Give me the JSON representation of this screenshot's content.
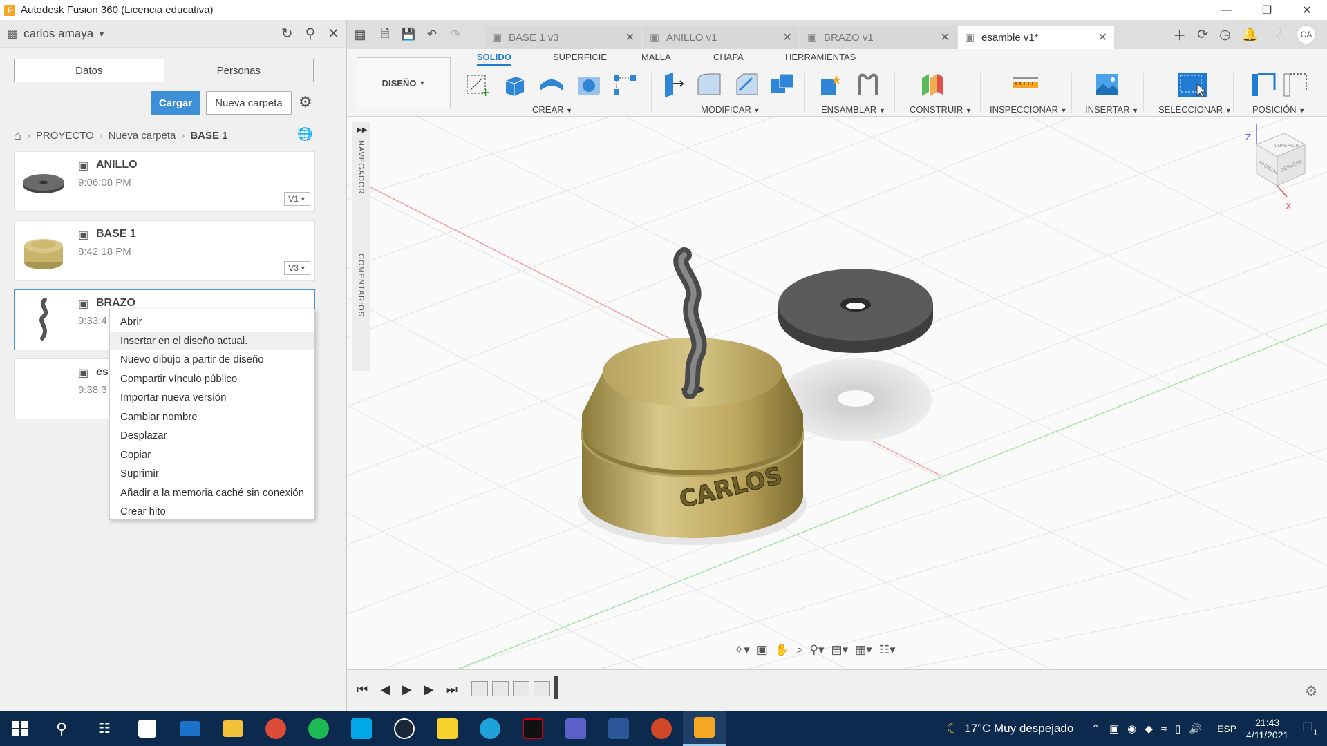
{
  "window": {
    "title": "Autodesk Fusion 360 (Licencia educativa)",
    "app_icon": "F"
  },
  "left_panel": {
    "user": "carlos amaya",
    "tabs": [
      "Datos",
      "Personas"
    ],
    "upload_label": "Cargar",
    "new_folder_label": "Nueva carpeta",
    "breadcrumb": [
      "PROYECTO",
      "Nueva carpeta",
      "BASE 1"
    ],
    "files": [
      {
        "name": "ANILLO",
        "time": "9:06:08 PM",
        "version": "V1"
      },
      {
        "name": "BASE 1",
        "time": "8:42:18 PM",
        "version": "V3"
      },
      {
        "name": "BRAZO",
        "time": "9:33:4",
        "version": ""
      },
      {
        "name": "es",
        "time": "9:38:3",
        "version": ""
      }
    ]
  },
  "context_menu": {
    "items": [
      "Abrir",
      "Insertar en el diseño actual.",
      "Nuevo dibujo a partir de diseño",
      "Compartir vínculo público",
      "Importar nueva versión",
      "Cambiar nombre",
      "Desplazar",
      "Copiar",
      "Suprimir",
      "Añadir a la memoria caché sin conexión",
      "Crear hito"
    ],
    "highlighted_index": 1
  },
  "doc_tabs": [
    {
      "label": "BASE 1 v3",
      "active": false
    },
    {
      "label": "ANILLO v1",
      "active": false
    },
    {
      "label": "BRAZO v1",
      "active": false
    },
    {
      "label": "esamble v1*",
      "active": true
    }
  ],
  "user_initials": "CA",
  "ribbon": {
    "workspace": "DISEÑO",
    "tabs": [
      "SOLIDO",
      "SUPERFICIE",
      "MALLA",
      "CHAPA",
      "HERRAMIENTAS"
    ],
    "groups": [
      "CREAR",
      "MODIFICAR",
      "ENSAMBLAR",
      "CONSTRUIR",
      "INSPECCIONAR",
      "INSERTAR",
      "SELECCIONAR",
      "POSICIÓN"
    ]
  },
  "viewport": {
    "nav_labels": [
      "NAVEGADOR",
      "COMENTARIOS"
    ],
    "viewcube_faces": [
      "SUPERIOR",
      "FRONTAL",
      "DERECHA"
    ],
    "axis_labels": [
      "Z",
      "X"
    ],
    "engraving": "CARLOS"
  },
  "taskbar": {
    "weather": "17°C  Muy despejado",
    "language": "ESP",
    "time": "21:43",
    "date": "4/11/2021",
    "notifications": "1"
  },
  "colors": {
    "accent": "#1f7bd3",
    "upload_button": "#3d8fd8",
    "taskbar": "#0c2a4e",
    "brass": "#c8b46a"
  }
}
